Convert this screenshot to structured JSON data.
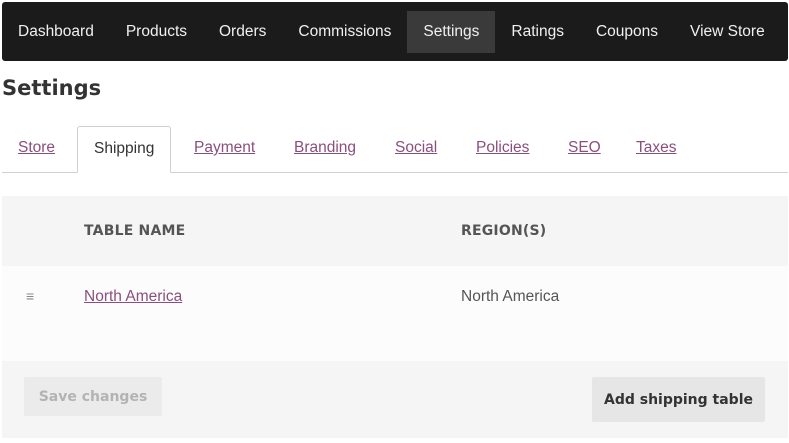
{
  "nav": {
    "items": [
      {
        "label": "Dashboard",
        "active": false
      },
      {
        "label": "Products",
        "active": false
      },
      {
        "label": "Orders",
        "active": false
      },
      {
        "label": "Commissions",
        "active": false
      },
      {
        "label": "Settings",
        "active": true
      },
      {
        "label": "Ratings",
        "active": false
      },
      {
        "label": "Coupons",
        "active": false
      },
      {
        "label": "View Store",
        "active": false
      }
    ]
  },
  "page": {
    "title": "Settings"
  },
  "tabs": {
    "items": [
      {
        "label": "Store",
        "active": false
      },
      {
        "label": "Shipping",
        "active": true
      },
      {
        "label": "Payment",
        "active": false
      },
      {
        "label": "Branding",
        "active": false
      },
      {
        "label": "Social",
        "active": false
      },
      {
        "label": "Policies",
        "active": false
      },
      {
        "label": "SEO",
        "active": false
      },
      {
        "label": "Taxes",
        "active": false
      }
    ]
  },
  "table": {
    "headers": {
      "name": "TABLE NAME",
      "regions": "REGION(S)"
    },
    "rows": [
      {
        "drag_icon": "≡",
        "name": "North America",
        "regions": "North America"
      }
    ]
  },
  "actions": {
    "save_label": "Save changes",
    "save_disabled": true,
    "add_label": "Add shipping table"
  },
  "colors": {
    "nav_bg": "#1b1b1b",
    "nav_active_bg": "#3a3a3a",
    "link": "#8a4f7d"
  }
}
